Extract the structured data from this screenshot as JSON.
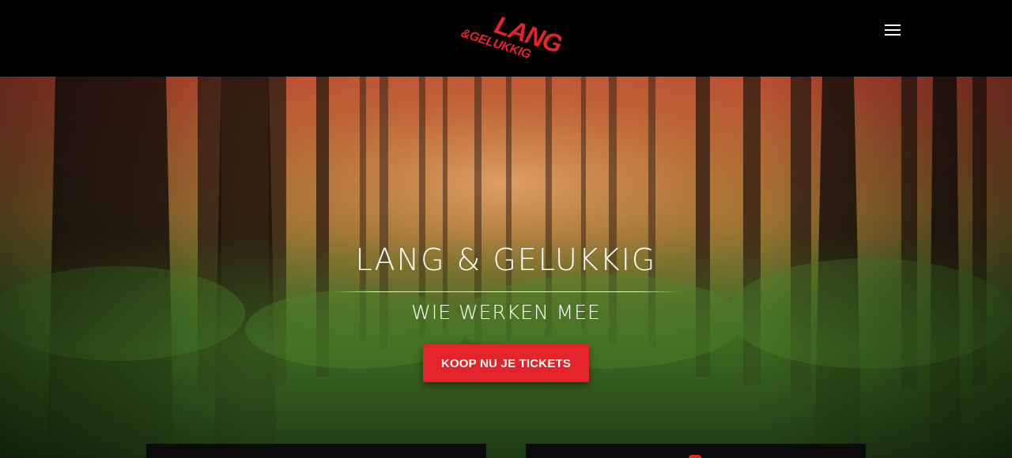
{
  "header": {
    "logo": {
      "text_top": "LANG",
      "text_bottom": "&GELUKKIG",
      "color": "#e3242b"
    },
    "menu_icon": "hamburger-menu-icon"
  },
  "hero": {
    "title": "LANG & GELUKKIG",
    "subtitle": "WIE WERKEN MEE",
    "cta_label": "KOOP NU JE TICKETS",
    "overlay_top_color": "#c0392b",
    "overlay_bottom_color": "#2e7d32"
  },
  "theme": {
    "accent": "#e3242b",
    "header_bg": "#000000"
  }
}
